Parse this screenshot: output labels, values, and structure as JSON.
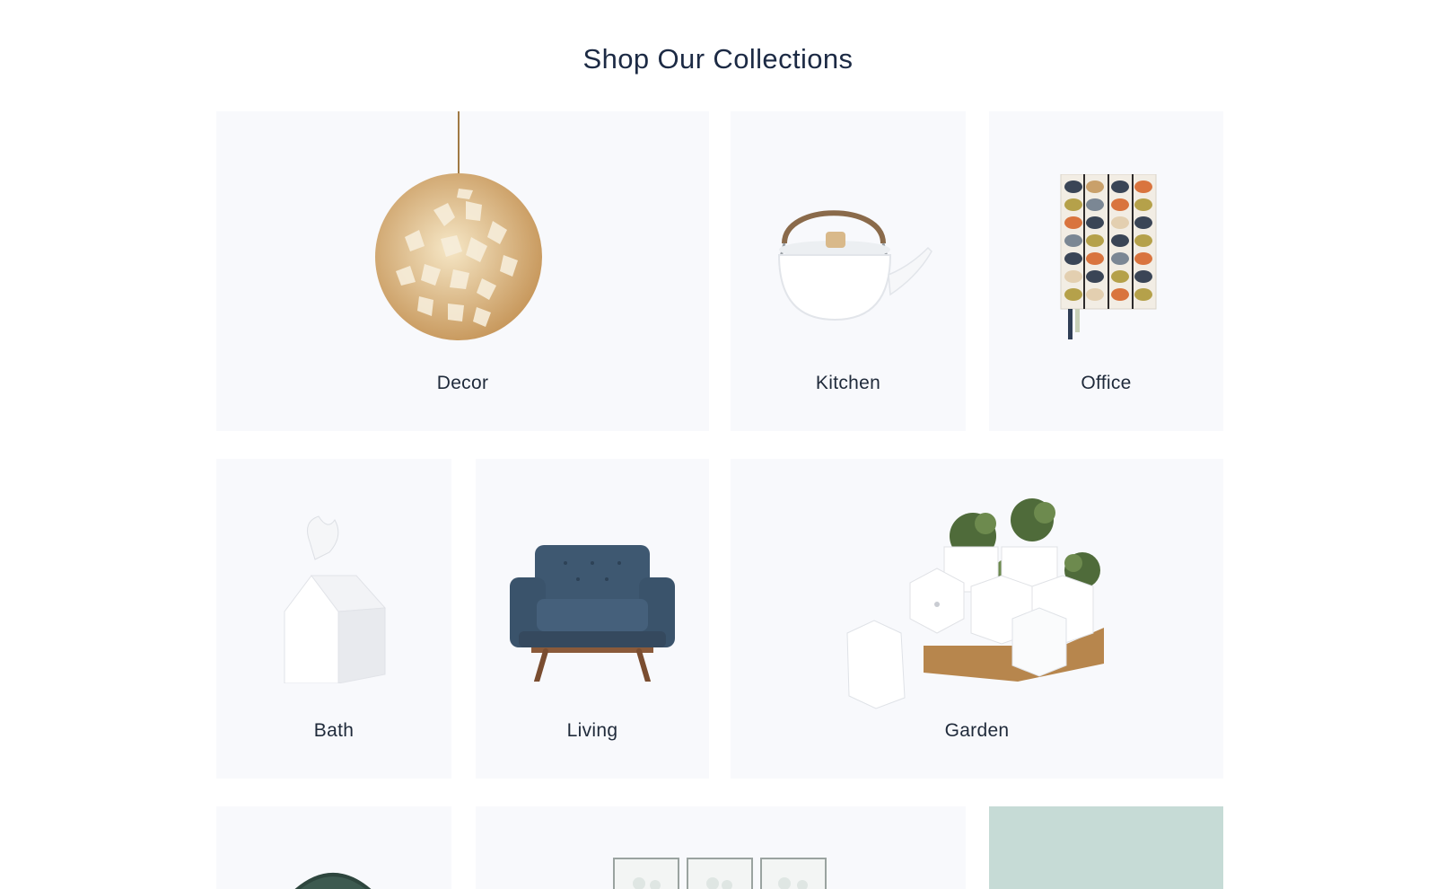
{
  "page": {
    "heading": "Shop Our Collections"
  },
  "collections": [
    {
      "label": "Decor",
      "icon": "pendant-lamp-icon"
    },
    {
      "label": "Kitchen",
      "icon": "kettle-icon"
    },
    {
      "label": "Office",
      "icon": "notebook-icon"
    },
    {
      "label": "Bath",
      "icon": "tissue-box-icon"
    },
    {
      "label": "Living",
      "icon": "armchair-icon"
    },
    {
      "label": "Garden",
      "icon": "planters-icon"
    },
    {
      "label": "",
      "icon": "fan-icon"
    },
    {
      "label": "",
      "icon": "glasses-icon"
    },
    {
      "label": "",
      "icon": ""
    }
  ],
  "colors": {
    "tile_bg": "#f8f9fc",
    "accent_tile_bg": "#c6dbd6",
    "heading": "#1c2a44"
  }
}
